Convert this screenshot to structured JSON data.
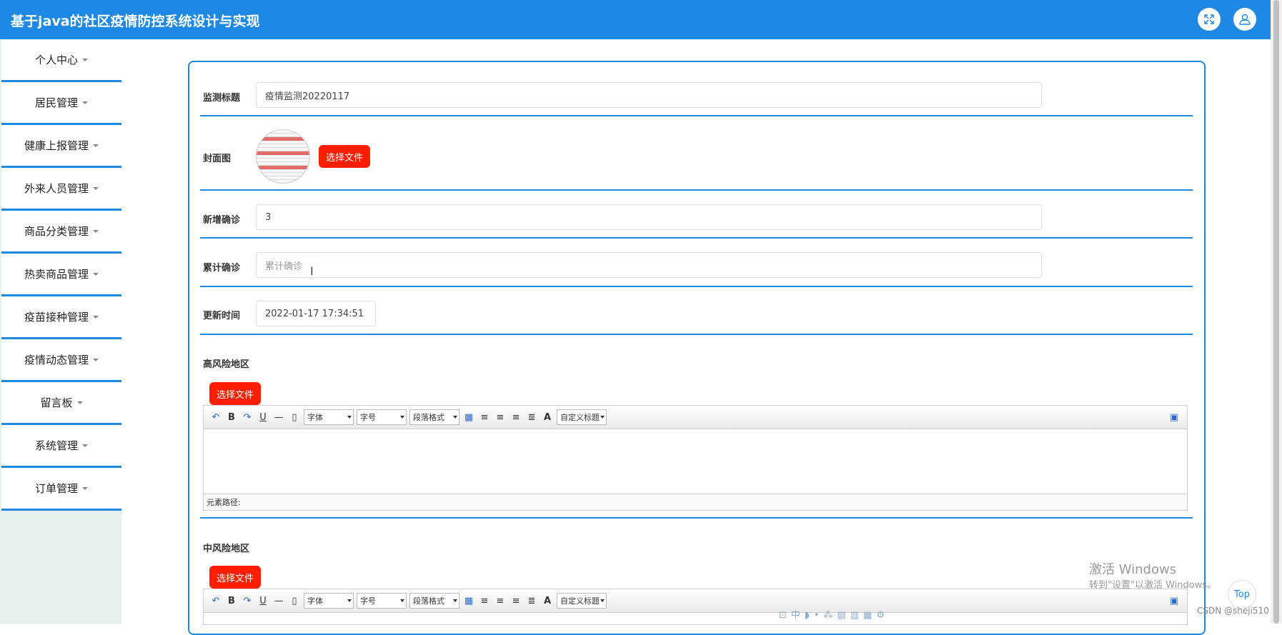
{
  "header": {
    "title": "基于java的社区疫情防控系统设计与实现"
  },
  "sidebar": {
    "items": [
      {
        "label": "个人中心"
      },
      {
        "label": "居民管理"
      },
      {
        "label": "健康上报管理"
      },
      {
        "label": "外来人员管理"
      },
      {
        "label": "商品分类管理"
      },
      {
        "label": "热卖商品管理"
      },
      {
        "label": "疫苗接种管理"
      },
      {
        "label": "疫情动态管理"
      },
      {
        "label": "留言板"
      },
      {
        "label": "系统管理"
      },
      {
        "label": "订单管理"
      }
    ]
  },
  "form": {
    "title_label": "监测标题",
    "title_value": "疫情监测20220117",
    "cover_label": "封面图",
    "choose_file": "选择文件",
    "new_label": "新增确诊",
    "new_value": "3",
    "total_label": "累计确诊",
    "total_placeholder": "累计确诊",
    "time_label": "更新时间",
    "time_value": "2022-01-17 17:34:51",
    "high_risk_label": "高风险地区",
    "mid_risk_label": "中风险地区"
  },
  "editor": {
    "font_family": "字体",
    "font_size": "字号",
    "paragraph": "段落格式",
    "custom_title": "自定义标题",
    "element_path": "元素路径:"
  },
  "overlay": {
    "activate_title": "激活 Windows",
    "activate_sub": "转到\"设置\"以激活 Windows。",
    "top": "Top",
    "csdn": "CSDN @sheji510"
  }
}
